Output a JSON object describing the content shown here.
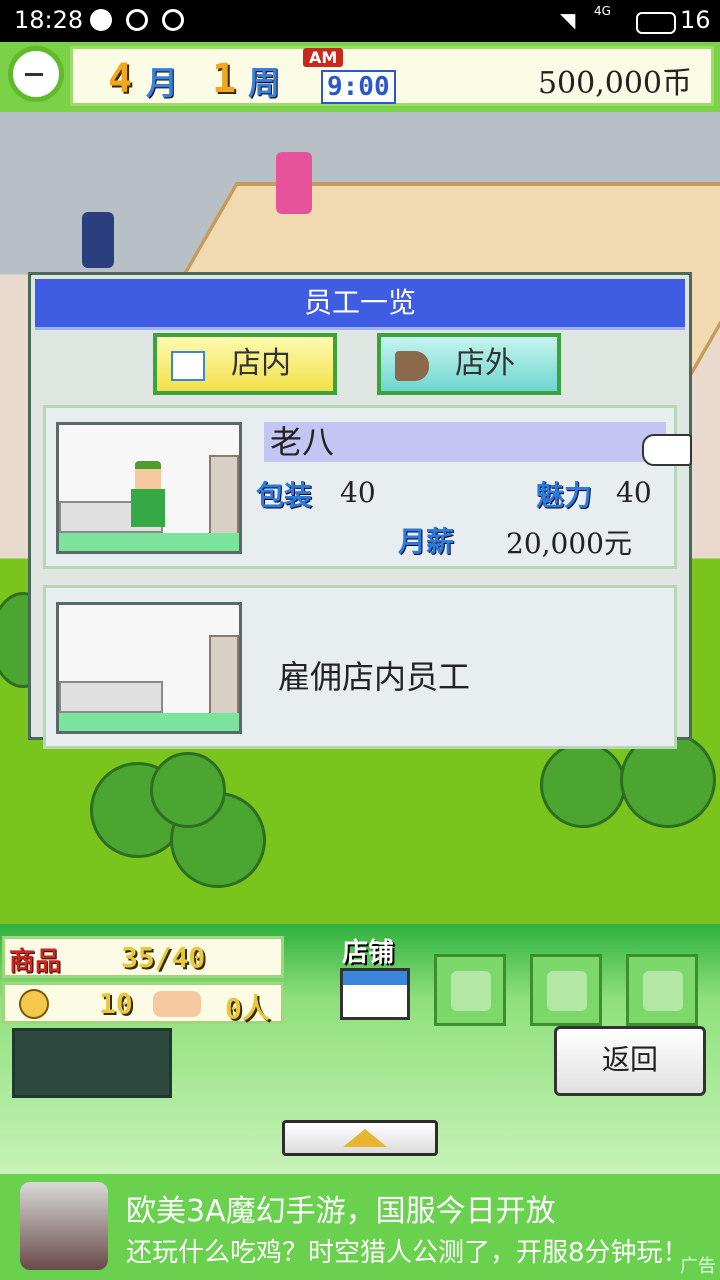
{
  "status_bar": {
    "time": "18:28",
    "network": "4G",
    "battery": "16"
  },
  "hud": {
    "month": "4",
    "month_unit": "月",
    "week": "1",
    "week_unit": "周",
    "am": "AM",
    "clock": "9:00",
    "money": "500,000币"
  },
  "dialog": {
    "title": "员工一览",
    "tabs": [
      {
        "label": "店内"
      },
      {
        "label": "店外"
      }
    ],
    "staff": [
      {
        "name": "老八",
        "stat1_label": "包装",
        "stat1_value": "40",
        "stat2_label": "魅力",
        "stat2_value": "40",
        "salary_label": "月薪",
        "salary_value": "20,000元"
      }
    ],
    "hire_label": "雇佣店内员工"
  },
  "bottom": {
    "goods_label": "商品",
    "goods_value": "35/40",
    "satisfaction_value": "10",
    "visitors_value": "0人",
    "shop_label": "店铺",
    "back_label": "返回"
  },
  "ad": {
    "line1": "欧美3A魔幻手游，国服今日开放",
    "line2": "还玩什么吃鸡？时空猎人公测了，开服8分钟玩！",
    "tag": "广告"
  },
  "colors": {
    "title_bar": "#3e5de2",
    "tab_inside": "#f1e04a",
    "tab_outside": "#6fd6cf",
    "hud_green": "#7bd147"
  }
}
